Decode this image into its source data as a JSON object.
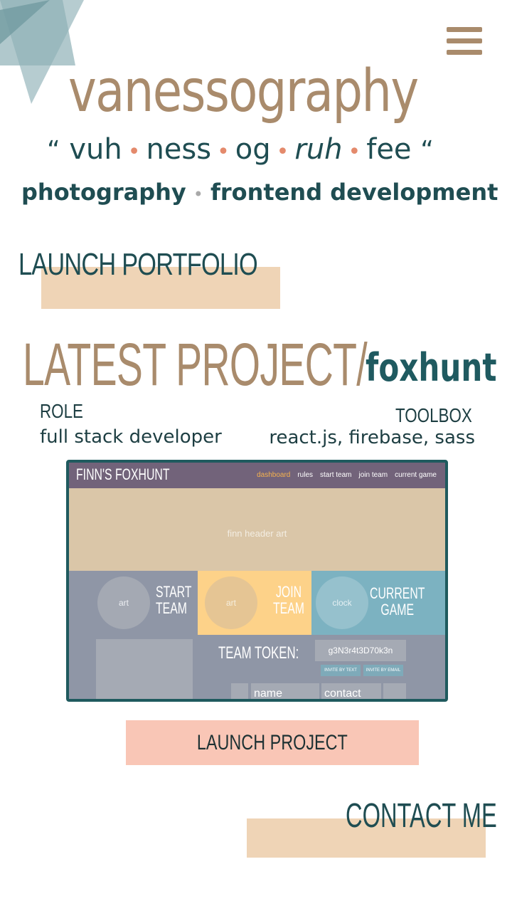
{
  "brand": {
    "name": "vanessography",
    "pronunciation": [
      "vuh",
      "ness",
      "og",
      "ruh",
      "fee"
    ],
    "open_quote": "“",
    "close_quote": "“",
    "tagline": [
      "photography",
      "frontend development"
    ]
  },
  "menu": {
    "icon": "hamburger-menu-icon"
  },
  "portfolio_button": {
    "label": "LAUNCH PORTFOLIO"
  },
  "latest_project": {
    "heading": "LATEST PROJECT/",
    "name": "foxhunt",
    "role_label": "ROLE",
    "role": "full stack developer",
    "toolbox_label": "TOOLBOX",
    "toolbox": "react.js, firebase, sass",
    "launch_label": "LAUNCH PROJECT"
  },
  "preview": {
    "logo": "FINN'S FOXHUNT",
    "nav": [
      "dashboard",
      "rules",
      "start team",
      "join team",
      "current game"
    ],
    "active_nav": "dashboard",
    "header_text": "finn header art",
    "tiles": [
      {
        "circle": "art",
        "title_line1": "START",
        "title_line2": "TEAM"
      },
      {
        "circle": "art",
        "title_line1": "JOIN",
        "title_line2": "TEAM"
      },
      {
        "circle": "clock",
        "title_line1": "CURRENT",
        "title_line2": "GAME"
      }
    ],
    "token_label": "TEAM TOKEN:",
    "token_value": "g3N3r4t3D70k3n",
    "invite_text": "INVITE BY TEXT",
    "invite_email": "INVITE BY EMAIL",
    "table_headers": [
      "name",
      "contact"
    ]
  },
  "contact_button": {
    "label": "CONTACT ME"
  },
  "colors": {
    "tan": "#a98b6c",
    "teal": "#1f4d52",
    "coral_dot": "#e48a6c",
    "highlight": "#efd4b6",
    "pink_button": "#f9c6b6"
  }
}
